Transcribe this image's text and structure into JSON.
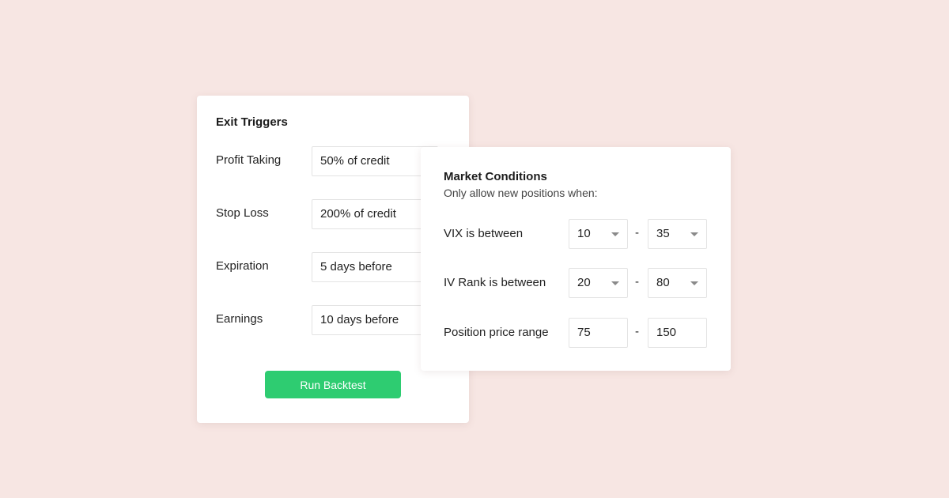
{
  "exit_triggers": {
    "title": "Exit Triggers",
    "rows": [
      {
        "label": "Profit Taking",
        "value": "50% of credit"
      },
      {
        "label": "Stop Loss",
        "value": "200% of credit"
      },
      {
        "label": "Expiration",
        "value": "5 days before"
      },
      {
        "label": "Earnings",
        "value": "10 days before"
      }
    ],
    "run_button_label": "Run Backtest"
  },
  "market_conditions": {
    "title": "Market Conditions",
    "subtitle": "Only allow new positions when:",
    "separator": "-",
    "rows": [
      {
        "label": "VIX is between",
        "min": "10",
        "max": "35",
        "type": "dropdown"
      },
      {
        "label": "IV Rank is between",
        "min": "20",
        "max": "80",
        "type": "dropdown"
      },
      {
        "label": "Position price range",
        "min": "75",
        "max": "150",
        "type": "text"
      }
    ]
  },
  "colors": {
    "background": "#f7e6e3",
    "card": "#ffffff",
    "accent_button": "#2ecc71",
    "field_border": "#e3e3e3",
    "caret": "#8a8a8a"
  },
  "icons": {
    "dropdown": "caret-down-icon"
  }
}
